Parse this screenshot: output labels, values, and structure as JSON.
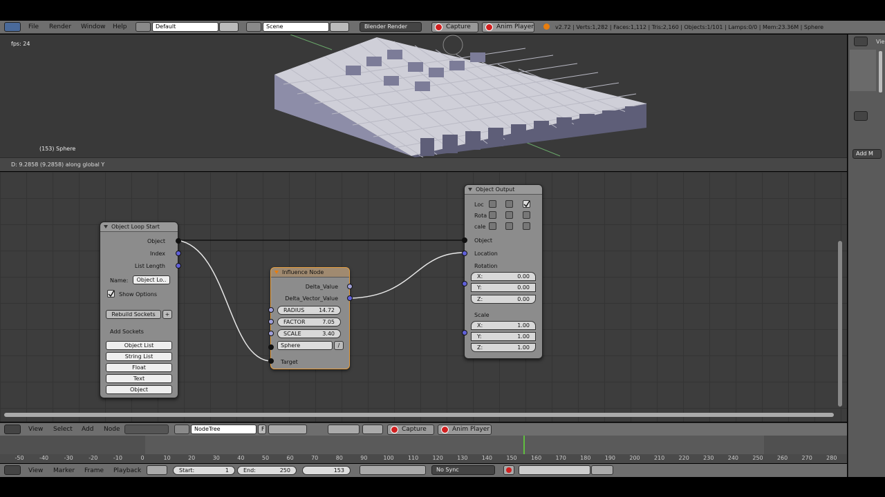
{
  "topbar": {
    "menus": [
      "File",
      "Render",
      "Window",
      "Help"
    ],
    "layout": "Default",
    "scene": "Scene",
    "engine": "Blender Render",
    "capture": "Capture",
    "anim_player": "Anim Player",
    "stats": "v2.72 | Verts:1,282 | Faces:1,112 | Tris:2,160 | Objects:1/101 | Lamps:0/0 | Mem:23.36M | Sphere"
  },
  "viewport": {
    "fps": "fps: 24",
    "object_label": "(153) Sphere",
    "status": "D: 9.2858 (9.2858) along global Y"
  },
  "nodes": {
    "loop_start": {
      "title": "Object Loop Start",
      "out_object": "Object",
      "out_index": "Index",
      "out_list_length": "List Length",
      "name_label": "Name:",
      "name_value": "Object Lo..",
      "show_options": "Show Options",
      "rebuild": "Rebuild Sockets",
      "add_sockets": "Add Sockets",
      "buttons": [
        "Object List",
        "String List",
        "Float",
        "Text",
        "Object"
      ]
    },
    "influence": {
      "title": "Influence Node",
      "out_delta_value": "Delta_Value",
      "out_delta_vector": "Delta_Vector_Value",
      "radius_k": "RADIUS",
      "radius_v": "14.72",
      "factor_k": "FACTOR",
      "factor_v": "7.05",
      "scale_k": "SCALE",
      "scale_v": "3.40",
      "object": "Sphere",
      "target": "Target"
    },
    "output": {
      "title": "Object Output",
      "rows": [
        "Loc",
        "Rota",
        "cale"
      ],
      "object": "Object",
      "location": "Location",
      "rotation": "Rotation",
      "rx": "X:",
      "rxv": "0.00",
      "ry": "Y:",
      "ryv": "0.00",
      "rz": "Z:",
      "rzv": "0.00",
      "scale": "Scale",
      "sx": "X:",
      "sxv": "1.00",
      "sy": "Y:",
      "syv": "1.00",
      "sz": "Z:",
      "szv": "1.00"
    }
  },
  "nodebar": {
    "menus": [
      "View",
      "Select",
      "Add",
      "Node"
    ],
    "tree": "NodeTree",
    "fake": "F",
    "capture": "Capture",
    "anim_player": "Anim Player"
  },
  "timeline": {
    "ticks": [
      "-50",
      "-40",
      "-30",
      "-20",
      "-10",
      "0",
      "10",
      "20",
      "30",
      "40",
      "50",
      "60",
      "70",
      "80",
      "90",
      "100",
      "110",
      "120",
      "130",
      "140",
      "150",
      "160",
      "170",
      "180",
      "190",
      "200",
      "210",
      "220",
      "230",
      "240",
      "250",
      "260",
      "270",
      "280"
    ]
  },
  "tlbar": {
    "menus": [
      "View",
      "Marker",
      "Frame",
      "Playback"
    ],
    "start_k": "Start:",
    "start_v": "1",
    "end_k": "End:",
    "end_v": "250",
    "current": "153",
    "sync": "No Sync"
  },
  "rightpanel": {
    "view": "Vie",
    "add": "Add M"
  }
}
